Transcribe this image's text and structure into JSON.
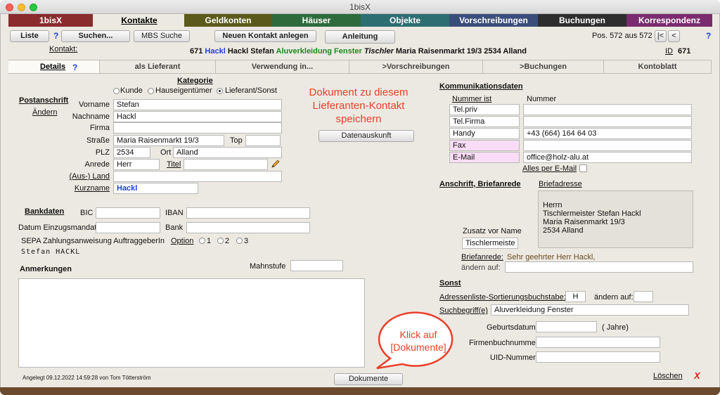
{
  "window": {
    "title": "1bisX"
  },
  "colors": {
    "bottom_bar": "#6b4a2e",
    "accent_red": "#e8402a",
    "link_blue": "#1f3fd8",
    "green": "#1a8a1a"
  },
  "main_tabs": [
    {
      "label": "1bisX",
      "color": "#8a2b2e"
    },
    {
      "label": "Kontakte",
      "color": "#ece9e2"
    },
    {
      "label": "Geldkonten",
      "color": "#5b5a1c"
    },
    {
      "label": "Häuser",
      "color": "#2e6b3c"
    },
    {
      "label": "Objekte",
      "color": "#2d6e72"
    },
    {
      "label": "Vorschreibungen",
      "color": "#3b4d7a"
    },
    {
      "label": "Buchungen",
      "color": "#2e2e2e"
    },
    {
      "label": "Korrespondenz",
      "color": "#7a2c6f"
    }
  ],
  "toolbar": {
    "liste": "Liste",
    "help": "?",
    "suchen": "Suchen...",
    "mbs_suche": "MBS Suche",
    "neuen_kontakt": "Neuen Kontakt anlegen",
    "anleitung": "Anleitung",
    "position": "Pos. 572 aus 572",
    "nav_first": "|<",
    "nav_prev": "<",
    "help_right": "?"
  },
  "contact_header": {
    "label": "Kontakt:",
    "number": "671",
    "name_blue": "Hackl",
    "name_rest": "Hackl Stefan",
    "keyword_green": "Aluverkleidung Fenster",
    "profession_italic": "Tischler",
    "address": "Maria Raisenmarkt 19/3 2534 Alland",
    "id_label": "ID",
    "id_value": "671"
  },
  "sub_tabs": [
    {
      "label": "Details"
    },
    {
      "label": "als Lieferant"
    },
    {
      "label": "Verwendung in..."
    },
    {
      "label": ">Vorschreibungen"
    },
    {
      "label": ">Buchungen"
    },
    {
      "label": "Kontoblatt"
    }
  ],
  "sub_tab_help": "?",
  "kategorie": {
    "title": "Kategorie",
    "options": [
      "Kunde",
      "Hauseigentümer",
      "Lieferant/Sonst"
    ],
    "selected": "Lieferant/Sonst"
  },
  "postanschrift": {
    "title": "Postanschrift",
    "aendern": "Ändern",
    "vorname_label": "Vorname",
    "vorname": "Stefan",
    "nachname_label": "Nachname",
    "nachname": "Hackl",
    "firma_label": "Firma",
    "firma": "",
    "strasse_label": "Straße",
    "strasse": "Maria Raisenmarkt 19/3",
    "top_label": "Top",
    "top": "",
    "plz_label": "PLZ",
    "plz": "2534",
    "ort_label": "Ort",
    "ort": "Alland",
    "anrede_label": "Anrede",
    "anrede": "Herr",
    "titel_label": "Titel",
    "titel": "",
    "land_label": "(Aus-) Land",
    "land": "",
    "kurzname_label": "Kurzname",
    "kurzname": "Hackl"
  },
  "annotation_top": {
    "text": "Dokument zu diesem Lieferanten-Kontakt speichern"
  },
  "datenauskunft": "Datenauskunft",
  "bankdaten": {
    "title": "Bankdaten",
    "bic_label": "BIC",
    "bic": "",
    "iban_label": "IBAN",
    "iban": "",
    "mandat_label": "Datum Einzugsmandat",
    "mandat": "",
    "bank_label": "Bank",
    "bank": "",
    "sepa_label": "SEPA Zahlungsanweisung AuftraggeberIn",
    "option_label": "Option",
    "options": [
      "1",
      "2",
      "3"
    ],
    "auftraggeber": "Stefan HACKL"
  },
  "anmerkungen": {
    "title": "Anmerkungen",
    "mahnstufe_label": "Mahnstufe",
    "mahnstufe": "",
    "text": ""
  },
  "footer": {
    "angelegt": "Angelegt 09.12.2022 14:59:28 von Tom Tötterström",
    "dokumente": "Dokumente",
    "loeschen": "Löschen",
    "delete_mark": "X"
  },
  "annotation_bottom": {
    "text": "Klick auf [Dokumente]"
  },
  "kommunikation": {
    "title": "Kommunikationsdaten",
    "col1": "Nummer ist",
    "col2": "Nummer",
    "rows": [
      {
        "type": "Tel.priv",
        "value": "",
        "pink": false
      },
      {
        "type": "Tel.Firma",
        "value": "",
        "pink": false
      },
      {
        "type": "Handy",
        "value": "+43 (664) 164 64 03",
        "pink": false
      },
      {
        "type": "Fax",
        "value": "",
        "pink": true
      },
      {
        "type": "E-Mail",
        "value": "office@holz-alu.at",
        "pink": true
      }
    ],
    "alles_email": "Alles per E-Mail"
  },
  "briefanrede_section": {
    "title": "Anschrift, Briefanrede",
    "briefadresse_label": "Briefadresse",
    "briefadresse_lines": [
      "Herrn",
      "Tischlermeister Stefan Hackl",
      "Maria Raisenmarkt 19/3",
      "2534 Alland"
    ],
    "zusatz_label": "Zusatz vor Name",
    "zusatz": "Tischlermeiste",
    "briefanrede_label": "Briefanrede:",
    "briefanrede": "Sehr geehrter Herr Hackl,",
    "aendern_auf_label": "ändern auf:",
    "aendern_auf": ""
  },
  "sonst": {
    "title": "Sonst",
    "sort_label": "Adressenliste-Sortierungsbuchstabe:",
    "sort": "H",
    "sort_aendern_label": "ändern auf:",
    "sort_aendern": "",
    "suchbegriff_label": "Suchbegriff(e)",
    "suchbegriff": "Aluverkleidung Fenster",
    "geburtsdatum_label": "Geburtsdatum",
    "geburtsdatum": "",
    "jahre_label": "( Jahre)",
    "firmenbuch_label": "Firmenbuchnummer",
    "firmenbuch": "",
    "uid_label": "UID-Nummer",
    "uid": ""
  }
}
